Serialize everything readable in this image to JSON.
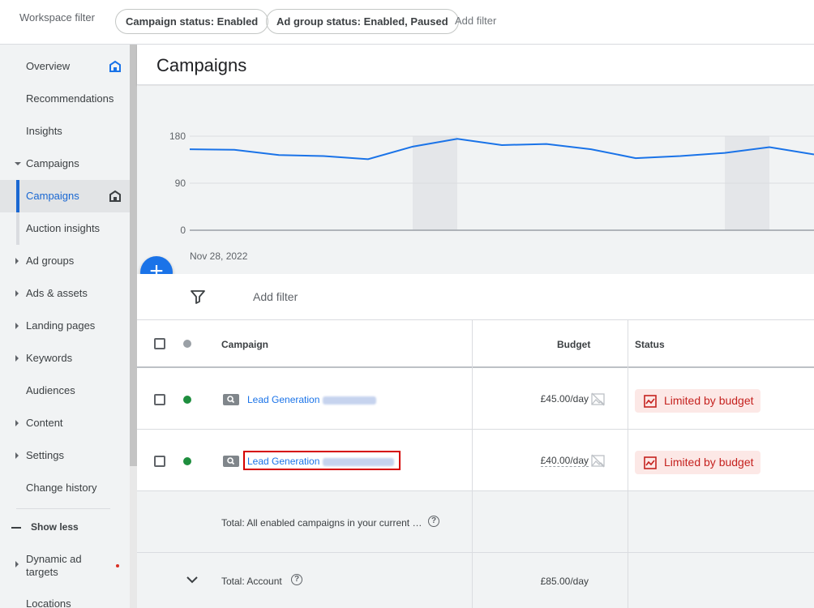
{
  "filterbar": {
    "label": "Workspace filter",
    "chips": [
      "Campaign status: Enabled",
      "Ad group status: Enabled, Paused"
    ],
    "add_filter": "Add filter"
  },
  "sidebar": {
    "items": [
      {
        "label": "Overview",
        "icon": "home-icon"
      },
      {
        "label": "Recommendations"
      },
      {
        "label": "Insights"
      },
      {
        "label": "Campaigns",
        "expanded": true
      },
      {
        "label": "Campaigns",
        "active": true,
        "icon": "home-icon"
      },
      {
        "label": "Auction insights"
      },
      {
        "label": "Ad groups"
      },
      {
        "label": "Ads & assets"
      },
      {
        "label": "Landing pages"
      },
      {
        "label": "Keywords"
      },
      {
        "label": "Audiences"
      },
      {
        "label": "Content"
      },
      {
        "label": "Settings"
      },
      {
        "label": "Change history"
      }
    ],
    "show_less": "Show less",
    "dynamic_ad_targets": "Dynamic ad targets",
    "locations": "Locations"
  },
  "main": {
    "title": "Campaigns"
  },
  "chart_data": {
    "type": "line",
    "title": "",
    "x_start_label": "Nov 28, 2022",
    "y_ticks": [
      0,
      90,
      180
    ],
    "ylim": [
      0,
      180
    ],
    "values": [
      155,
      154,
      144,
      142,
      136,
      160,
      175,
      163,
      165,
      155,
      138,
      142,
      148,
      159,
      145
    ],
    "line_color": "#1a73e8",
    "shaded_indices": [
      [
        5,
        6
      ],
      [
        12,
        13
      ]
    ]
  },
  "filter_row": {
    "add_filter": "Add filter"
  },
  "table": {
    "headers": {
      "campaign": "Campaign",
      "budget": "Budget",
      "status": "Status"
    },
    "rows": [
      {
        "campaign": "Lead Generation",
        "budget": "£45.00/day",
        "status": "Limited by budget",
        "status_color": "#1e8e3e"
      },
      {
        "campaign": "Lead Generation",
        "budget": "£40.00/day",
        "status": "Limited by budget",
        "status_color": "#1e8e3e"
      }
    ],
    "totals": [
      {
        "label": "Total: All enabled campaigns in your current …",
        "budget": ""
      },
      {
        "label": "Total: Account",
        "budget": "£85.00/day"
      }
    ]
  },
  "colors": {
    "accent": "#1a73e8",
    "enabled_green": "#1e8e3e",
    "limited_red": "#c5221f"
  }
}
